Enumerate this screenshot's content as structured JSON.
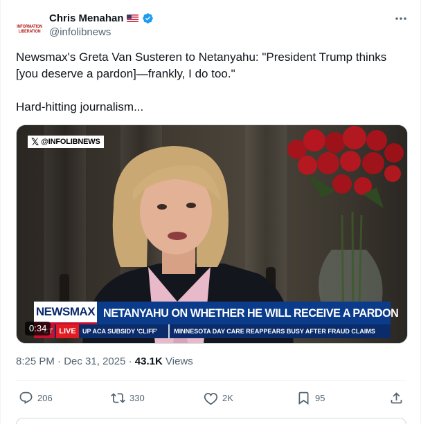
{
  "author": {
    "name": "Chris Menahan",
    "handle": "@infolibnews",
    "avatar_text": [
      "INFORMATION",
      "LIBERATION"
    ],
    "flag_icon": "us-flag-icon",
    "verified_icon": "verified-badge-icon"
  },
  "tweet": {
    "line1": "Newsmax's Greta Van Susteren to Netanyahu: \"President Trump thinks [you deserve a pardon]—frankly, I do too.\"",
    "line2": "Hard-hitting journalism..."
  },
  "video": {
    "watermark": "@INFOLIBNEWS",
    "network_logo": "NEWSMAX",
    "headline": "NETANYAHU ON WHETHER HE WILL RECEIVE A PARDON",
    "ticker_prefix": "CT",
    "live_label": "LIVE",
    "ticker_item_1": "UP ACA SUBSIDY 'CLIFF'",
    "ticker_item_2": "MINNESOTA DAY CARE REAPPEARS BUSY AFTER FRAUD CLAIMS",
    "duration": "0:34"
  },
  "meta": {
    "time": "8:25 PM",
    "dot": "·",
    "date": "Dec 31, 2025",
    "views_count": "43.1K",
    "views_label": "Views"
  },
  "actions": {
    "replies": "206",
    "reposts": "330",
    "likes": "2K",
    "bookmarks": "95"
  },
  "colors": {
    "accent": "#1d9bf0",
    "text_secondary": "#536471",
    "newsmax_blue": "#0b3c8c",
    "live_red": "#e11b22"
  }
}
